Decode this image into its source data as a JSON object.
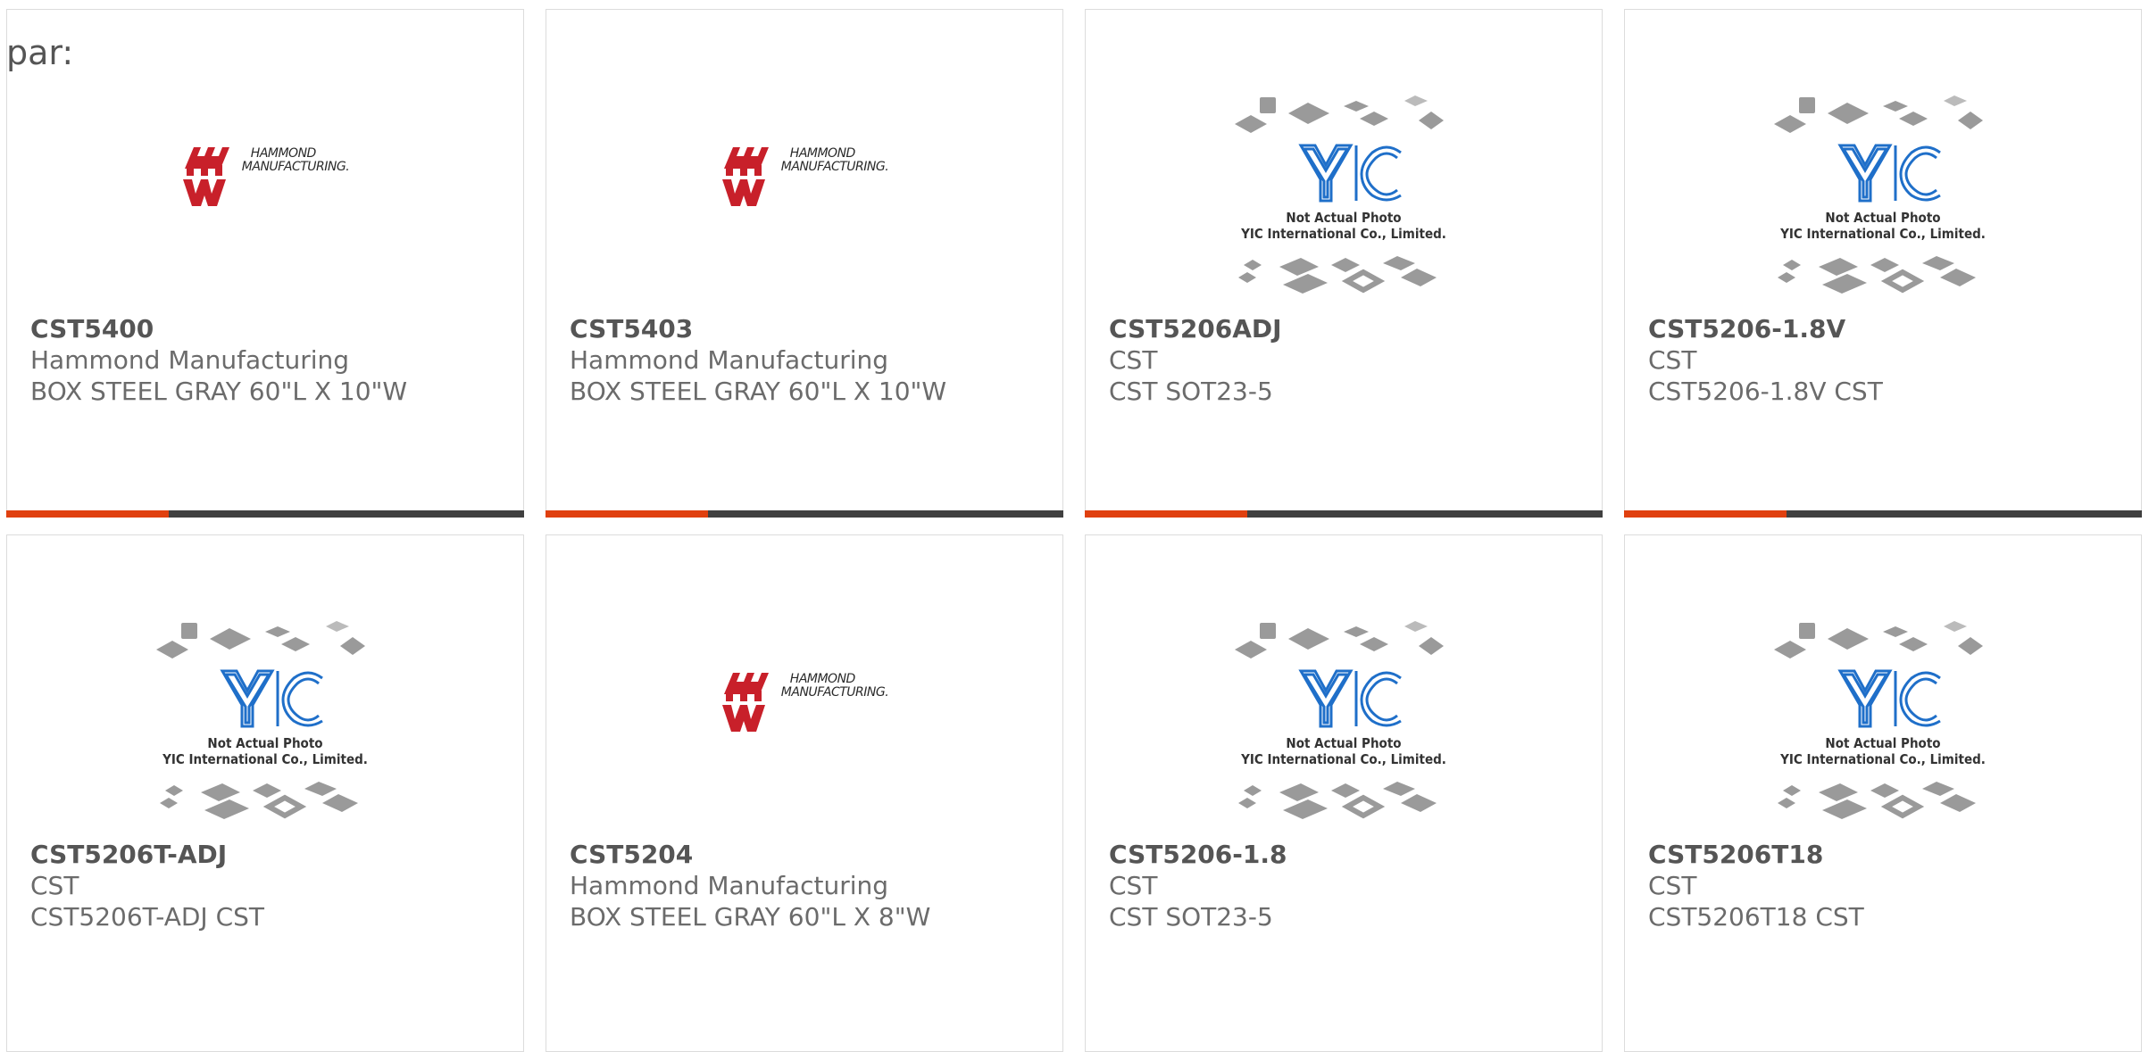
{
  "heading": "par:",
  "colors": {
    "accent_bar": "#e0400f",
    "bar_track": "#404040",
    "card_border": "#dcdcdc",
    "yic_blue": "#1f6fc9",
    "hammond_red": "#c8202a"
  },
  "products": [
    {
      "part_number": "CST5400",
      "manufacturer": "Hammond Manufacturing",
      "description": "BOX STEEL GRAY 60\"L X 10\"W",
      "image": "hammond-logo"
    },
    {
      "part_number": "CST5403",
      "manufacturer": "Hammond Manufacturing",
      "description": "BOX STEEL GRAY 60\"L X 10\"W",
      "image": "hammond-logo"
    },
    {
      "part_number": "CST5206ADJ",
      "manufacturer": "CST",
      "description": "CST SOT23-5",
      "image": "yic-placeholder"
    },
    {
      "part_number": "CST5206-1.8V",
      "manufacturer": "CST",
      "description": "CST5206-1.8V CST",
      "image": "yic-placeholder"
    },
    {
      "part_number": "CST5206T-ADJ",
      "manufacturer": "CST",
      "description": "CST5206T-ADJ CST",
      "image": "yic-placeholder"
    },
    {
      "part_number": "CST5204",
      "manufacturer": "Hammond Manufacturing",
      "description": "BOX STEEL GRAY 60\"L X 8\"W",
      "image": "hammond-logo"
    },
    {
      "part_number": "CST5206-1.8",
      "manufacturer": "CST",
      "description": "CST SOT23-5",
      "image": "yic-placeholder"
    },
    {
      "part_number": "CST5206T18",
      "manufacturer": "CST",
      "description": "CST5206T18 CST",
      "image": "yic-placeholder"
    }
  ],
  "hammond_logo": {
    "line1": "HAMMOND",
    "line2": "MANUFACTURING."
  },
  "yic_placeholder": {
    "line1": "Not Actual Photo",
    "line2": "YIC International Co., Limited."
  }
}
